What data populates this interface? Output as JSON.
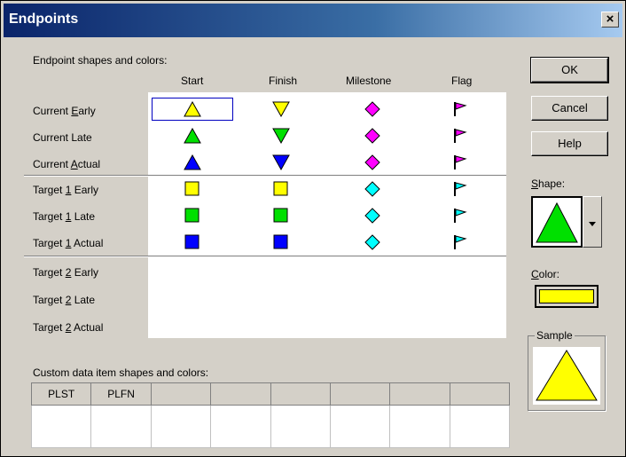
{
  "window": {
    "title": "Endpoints"
  },
  "section_label": "Endpoint shapes and colors:",
  "columns": [
    "Start",
    "Finish",
    "Milestone",
    "Flag"
  ],
  "rows": [
    {
      "pre": "Current ",
      "key": "E",
      "post": "arly"
    },
    {
      "pre": "Current Late",
      "key": "",
      "post": ""
    },
    {
      "pre": "Current ",
      "key": "A",
      "post": "ctual"
    },
    {
      "pre": "Target ",
      "key": "1",
      "post": " Early"
    },
    {
      "pre": "Target ",
      "key": "1",
      "post": " Late"
    },
    {
      "pre": "Target ",
      "key": "1",
      "post": " Actual"
    },
    {
      "pre": "Target ",
      "key": "2",
      "post": " Early"
    },
    {
      "pre": "Target ",
      "key": "2",
      "post": " Late"
    },
    {
      "pre": "Target ",
      "key": "2",
      "post": " Actual"
    }
  ],
  "colors": {
    "yellow": "#ffff00",
    "green": "#00e000",
    "blue": "#0000ff",
    "magenta": "#ff00ff",
    "cyan": "#00ffff"
  },
  "buttons": {
    "ok": "OK",
    "cancel": "Cancel",
    "help": "Help"
  },
  "shape_label": "Shape:",
  "color_label": "Color:",
  "sample_label": "Sample",
  "custom_label": "Custom data item shapes and colors:",
  "custom_columns": [
    "PLST",
    "PLFN",
    "",
    "",
    "",
    "",
    "",
    ""
  ]
}
